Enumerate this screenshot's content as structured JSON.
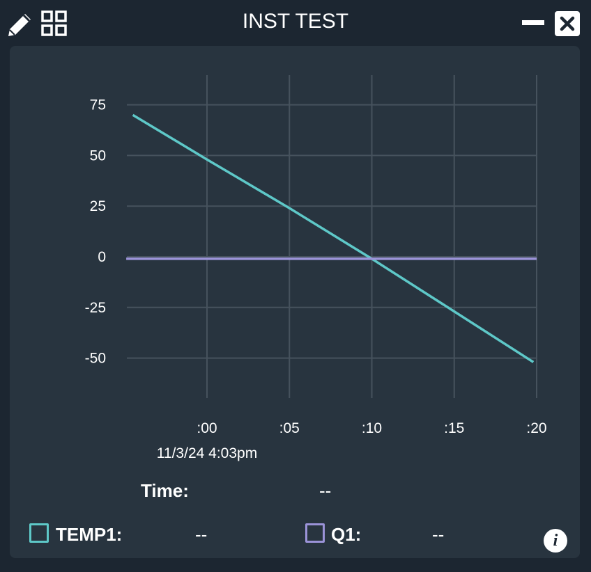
{
  "window": {
    "title": "INST TEST"
  },
  "icons": {
    "edit": "pencil-icon",
    "layout": "grid-icon",
    "minimize": "minimize-icon",
    "close": "close-icon",
    "info": "info-icon",
    "info_glyph": "i"
  },
  "colors": {
    "temp1": "#5ec8c8",
    "q1": "#9b93d8",
    "background": "#1c2631",
    "panel": "#28343f"
  },
  "chart_data": {
    "type": "line",
    "title": "",
    "xlabel": "",
    "ylabel": "",
    "x_ticks": [
      ":00",
      ":05",
      ":10",
      ":15",
      ":20"
    ],
    "x_tick_values": [
      0,
      5,
      10,
      15,
      20
    ],
    "x_start_label": "11/3/24 4:03pm",
    "xlim": [
      -5,
      20
    ],
    "y_ticks": [
      "75",
      "50",
      "25",
      "0",
      "-25",
      "-50"
    ],
    "y_tick_values": [
      75,
      50,
      25,
      0,
      -25,
      -50
    ],
    "ylim": [
      -50,
      75
    ],
    "grid": true,
    "series": [
      {
        "name": "TEMP1",
        "x": [
          -4.5,
          0,
          5,
          10,
          15,
          19.8
        ],
        "y": [
          70,
          48,
          24,
          -1,
          -27,
          -52
        ]
      },
      {
        "name": "Q1",
        "x": [
          -4.9,
          20
        ],
        "y": [
          -1,
          -1
        ]
      }
    ]
  },
  "readout": {
    "time_label": "Time:",
    "time_value": "--",
    "items": [
      {
        "label": "TEMP1:",
        "value": "--"
      },
      {
        "label": "Q1:",
        "value": "--"
      }
    ]
  }
}
